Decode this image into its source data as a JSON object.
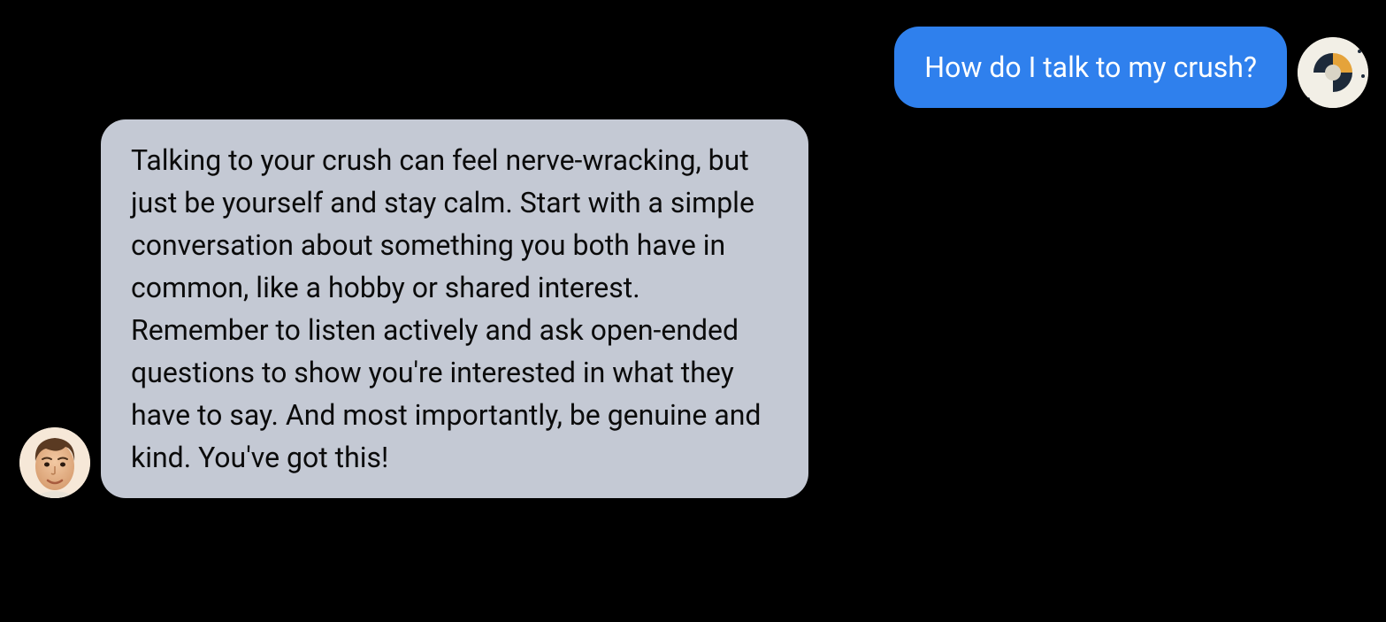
{
  "messages": {
    "user": {
      "text": "How do I talk to my crush?"
    },
    "assistant": {
      "text": "Talking to your crush can feel nerve-wracking, but just be yourself and stay calm. Start with a simple conversation about something you both have in common, like a hobby or shared interest. Remember to listen actively and ask open-ended questions to show you're interested in what they have to say. And most importantly, be genuine and kind. You've got this!"
    }
  },
  "colors": {
    "user_bubble": "#2f80ed",
    "assistant_bubble": "#c4c9d4",
    "background": "#000000"
  }
}
